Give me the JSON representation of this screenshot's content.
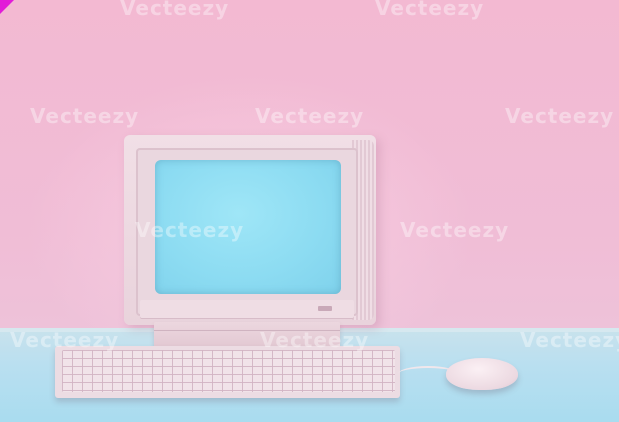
{
  "watermark": {
    "text": "Vecteezy"
  },
  "colors": {
    "wall": "#f1bbd4",
    "desk": "#b3def0",
    "screen": "#91def3",
    "corner_mark": "#e21bd8"
  }
}
